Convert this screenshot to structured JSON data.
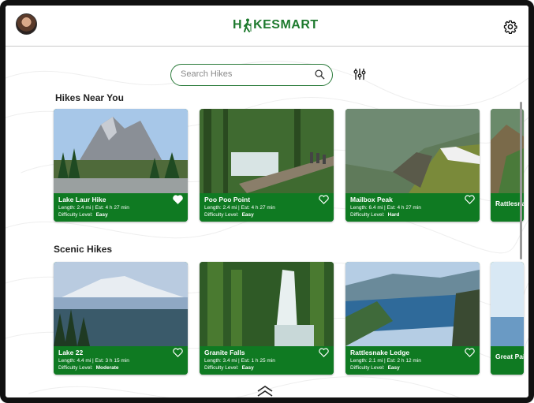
{
  "app": {
    "logo_prefix": "H",
    "logo_suffix": "KESMART"
  },
  "search": {
    "placeholder": "Search Hikes"
  },
  "sections": [
    {
      "title": "Hikes Near You",
      "hikes": [
        {
          "name": "Lake Laur Hike",
          "meta": "Length: 2.4 mi | Est: 4 h 27 min",
          "difficulty_label": "Difficulty Level:",
          "difficulty": "Easy",
          "favorite": true
        },
        {
          "name": "Poo Poo Point",
          "meta": "Length: 2.4 mi | Est: 4 h 27 min",
          "difficulty_label": "Difficulty Level:",
          "difficulty": "Easy",
          "favorite": false
        },
        {
          "name": "Mailbox Peak",
          "meta": "Length: 6.4 mi | Est: 4 h 27 min",
          "difficulty_label": "Difficulty Level:",
          "difficulty": "Hard",
          "favorite": false
        },
        {
          "name": "Rattlesna"
        }
      ]
    },
    {
      "title": "Scenic Hikes",
      "hikes": [
        {
          "name": "Lake 22",
          "meta": "Length: 4.4 mi | Est: 3 h 15 min",
          "difficulty_label": "Difficulty Level:",
          "difficulty": "Moderate",
          "favorite": false
        },
        {
          "name": "Granite Falls",
          "meta": "Length: 3.4 mi | Est: 1 h 25 min",
          "difficulty_label": "Difficulty Level:",
          "difficulty": "Easy",
          "favorite": false
        },
        {
          "name": "Rattlesnake Ledge",
          "meta": "Length: 2.1 mi | Est: 2 h 12 min",
          "difficulty_label": "Difficulty Level:",
          "difficulty": "Easy",
          "favorite": false
        },
        {
          "name": "Great Pain"
        }
      ]
    }
  ],
  "colors": {
    "brand_green": "#1e7a2e",
    "card_green": "#0f7a22"
  },
  "icons": [
    "avatar",
    "hiker-icon",
    "gear-icon",
    "search-icon",
    "filter-icon",
    "heart-icon",
    "chevron-up-icon"
  ]
}
